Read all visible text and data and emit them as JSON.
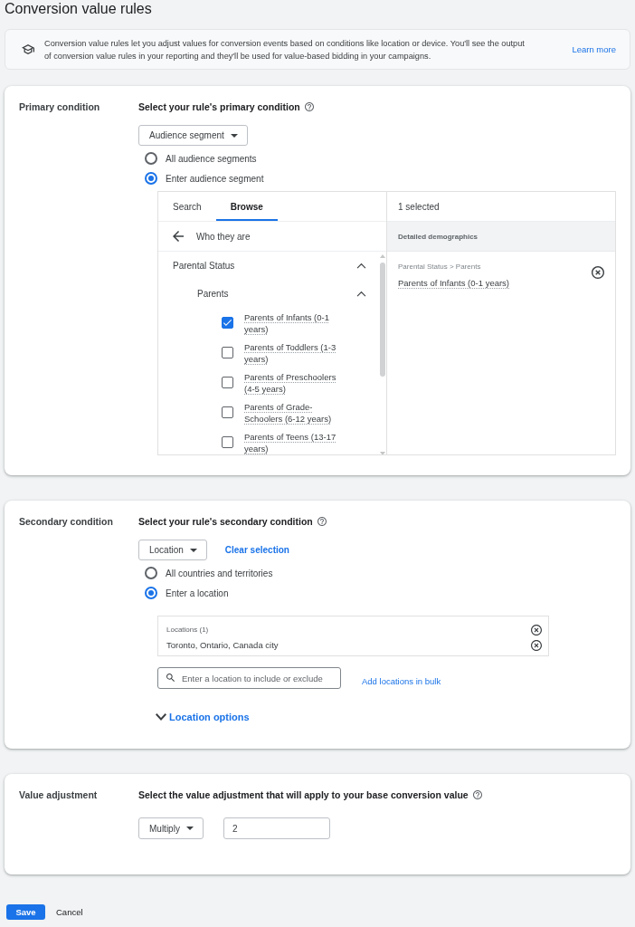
{
  "page": {
    "title": "Conversion value rules"
  },
  "info_banner": {
    "text": "Conversion value rules let you adjust values for conversion events based on conditions like location or device. You'll see the output of conversion value rules in your reporting and they'll be used for value-based bidding in your campaigns.",
    "link": "Learn more"
  },
  "primary_condition": {
    "label": "Primary condition",
    "heading": "Select your rule's primary condition",
    "dropdown": "Audience segment",
    "options": [
      {
        "label": "All audience segments",
        "selected": false
      },
      {
        "label": "Enter audience segment",
        "selected": true
      }
    ],
    "picker": {
      "tabs": [
        {
          "label": "Search",
          "selected": false
        },
        {
          "label": "Browse",
          "selected": true
        }
      ],
      "back_label": "Who they are",
      "tree": [
        {
          "label": "Parental Status",
          "expanded": true,
          "children": [
            {
              "label": "Parents",
              "expanded": true,
              "children": [
                {
                  "label": "Parents of Infants (0-1 years)",
                  "checked": true
                },
                {
                  "label": "Parents of Toddlers (1-3 years)",
                  "checked": false
                },
                {
                  "label": "Parents of Preschoolers (4-5 years)",
                  "checked": false
                },
                {
                  "label": "Parents of Grade-Schoolers (6-12 years)",
                  "checked": false
                },
                {
                  "label": "Parents of Teens (13-17 years)",
                  "checked": false
                }
              ]
            }
          ]
        }
      ],
      "selected_count": "1 selected",
      "selected_group": "Detailed demographics",
      "selected_items": [
        {
          "path": "Parental Status > Parents",
          "label": "Parents of Infants (0-1 years)"
        }
      ]
    }
  },
  "secondary_condition": {
    "label": "Secondary condition",
    "heading": "Select your rule's secondary condition",
    "dropdown": "Location",
    "clear_link": "Clear selection",
    "options": [
      {
        "label": "All countries and territories",
        "selected": false
      },
      {
        "label": "Enter a location",
        "selected": true
      }
    ],
    "locations": {
      "header": "Locations (1)",
      "items": [
        {
          "label": "Toronto, Ontario, Canada city"
        }
      ]
    },
    "search": {
      "placeholder": "Enter a location to include or exclude"
    },
    "bulk_link": "Add locations in bulk",
    "options_toggle": {
      "label": "Location options",
      "expanded": false
    }
  },
  "value_adjustment": {
    "label": "Value adjustment",
    "heading": "Select the value adjustment that will apply to your base conversion value",
    "dropdown": "Multiply",
    "value": "2"
  },
  "actions": [
    {
      "label": "Save",
      "kind": "primary"
    },
    {
      "label": "Cancel",
      "kind": "text"
    }
  ]
}
